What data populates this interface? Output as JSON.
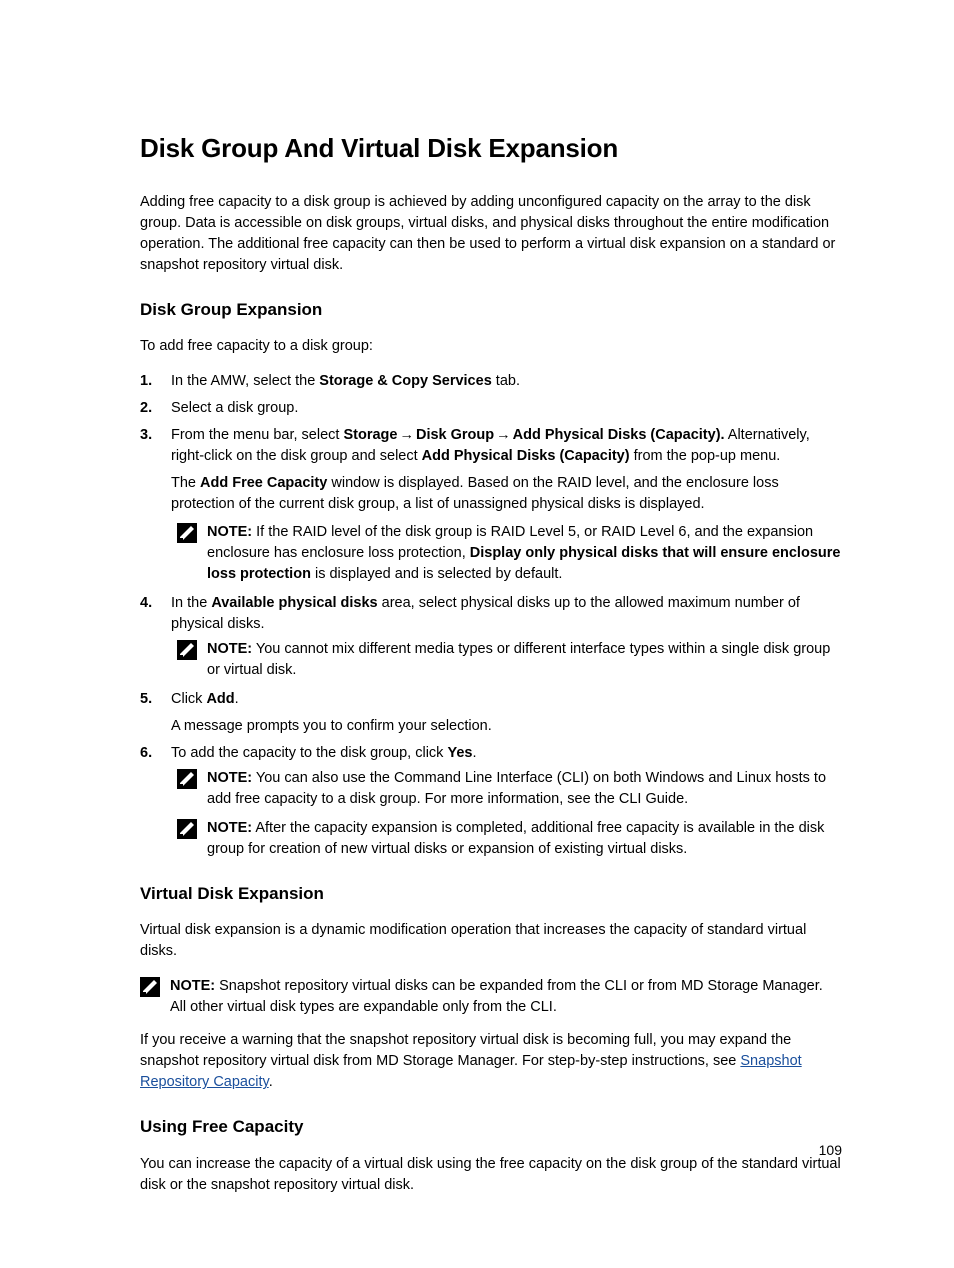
{
  "page_number": "109",
  "title": "Disk Group And Virtual Disk Expansion",
  "intro": "Adding free capacity to a disk group is achieved by adding unconfigured capacity on the array to the disk group. Data is accessible on disk groups, virtual disks, and physical disks throughout the entire modification operation. The additional free capacity can then be used to perform a virtual disk expansion on a standard or snapshot repository virtual disk.",
  "section1": {
    "heading": "Disk Group Expansion",
    "lead": "To add free capacity to a disk group:",
    "steps": {
      "s1_pre": "In the AMW, select the ",
      "s1_bold": "Storage & Copy Services",
      "s1_post": " tab.",
      "s2": "Select a disk group.",
      "s3_pre": "From the menu bar, select ",
      "s3_path1": "Storage",
      "s3_path2": "Disk Group",
      "s3_path3": "Add Physical Disks (Capacity).",
      "s3_mid": " Alternatively, right-click on the disk group and select ",
      "s3_b2": "Add Physical Disks (Capacity)",
      "s3_post": " from the pop-up menu.",
      "s3_para_pre": "The ",
      "s3_para_b": "Add Free Capacity",
      "s3_para_post": " window is displayed. Based on the RAID level, and the enclosure loss protection of the current disk group, a list of unassigned physical disks is displayed.",
      "s3_note_label": "NOTE:",
      "s3_note_pre": " If the RAID level of the disk group is RAID Level 5, or RAID Level 6, and the expansion enclosure has enclosure loss protection, ",
      "s3_note_b": "Display only physical disks that will ensure enclosure loss protection",
      "s3_note_post": " is displayed and is selected by default.",
      "s4_pre": "In the ",
      "s4_b": "Available physical disks",
      "s4_post": " area, select physical disks up to the allowed maximum number of physical disks.",
      "s4_note_label": "NOTE:",
      "s4_note_text": " You cannot mix different media types or different interface types within a single disk group or virtual disk.",
      "s5_pre": "Click ",
      "s5_b": "Add",
      "s5_post": ".",
      "s5_para": "A message prompts you to confirm your selection.",
      "s6_pre": "To add the capacity to the disk group, click ",
      "s6_b": "Yes",
      "s6_post": ".",
      "s6_note1_label": "NOTE:",
      "s6_note1_text": " You can also use the Command Line Interface (CLI) on both Windows and Linux hosts to add free capacity to a disk group. For more information, see the CLI Guide.",
      "s6_note2_label": "NOTE:",
      "s6_note2_text": " After the capacity expansion is completed, additional free capacity is available in the disk group for creation of new virtual disks or expansion of existing virtual disks."
    }
  },
  "section2": {
    "heading": "Virtual Disk Expansion",
    "para1": "Virtual disk expansion is a dynamic modification operation that increases the capacity of standard virtual disks.",
    "note_label": "NOTE:",
    "note_text": " Snapshot repository virtual disks can be expanded from the CLI or from MD Storage Manager. All other virtual disk types are expandable only from the CLI.",
    "para2_pre": "If you receive a warning that the snapshot repository virtual disk is becoming full, you may expand the snapshot repository virtual disk from MD Storage Manager. For step-by-step instructions, see ",
    "para2_link": "Snapshot Repository Capacity",
    "para2_post": "."
  },
  "section3": {
    "heading": "Using Free Capacity",
    "para": "You can increase the capacity of a virtual disk using the free capacity on the disk group of the standard virtual disk or the snapshot repository virtual disk."
  },
  "icons": {
    "note": "note-icon"
  }
}
